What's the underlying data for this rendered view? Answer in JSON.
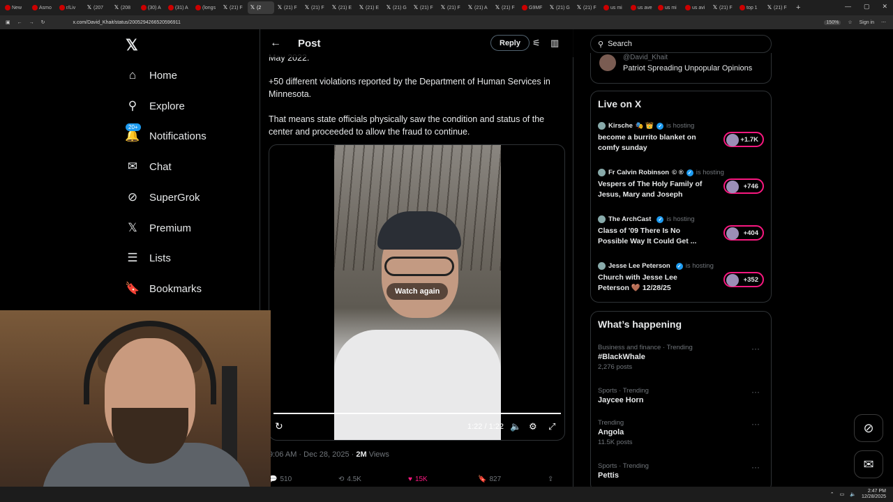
{
  "browser": {
    "tabs": [
      "New",
      "Asmo",
      "r/Liv",
      "(207",
      "(208",
      "(30) A",
      "(31) A",
      "(longs",
      "(21) F",
      "(2",
      "(21) F",
      "(21) F",
      "(21) E",
      "(21) E",
      "(21) G",
      "(21) F",
      "(21) F",
      "(21) A",
      "(21) F",
      "G9MF",
      "(21) G",
      "(21) F",
      "us mi",
      "us ave",
      "us mi",
      "us avi",
      "(21) F",
      "top 1",
      "(21) F"
    ],
    "active_tab_index": 9,
    "url": "x.com/David_Khait/status/2005294266520596911",
    "zoom": "150%",
    "profile": "Sign in"
  },
  "nav": {
    "items": [
      {
        "label": "Home",
        "icon": "home-icon",
        "glyph": "⌂"
      },
      {
        "label": "Explore",
        "icon": "search-icon",
        "glyph": "⚲"
      },
      {
        "label": "Notifications",
        "icon": "bell-icon",
        "glyph": "🔔",
        "badge": "20+"
      },
      {
        "label": "Chat",
        "icon": "mail-icon",
        "glyph": "✉"
      },
      {
        "label": "SuperGrok",
        "icon": "grok-icon",
        "glyph": "⊘"
      },
      {
        "label": "Premium",
        "icon": "x-logo-icon",
        "glyph": "𝕏"
      },
      {
        "label": "Lists",
        "icon": "list-icon",
        "glyph": "☰"
      },
      {
        "label": "Bookmarks",
        "icon": "bookmark-icon",
        "glyph": "🔖"
      }
    ]
  },
  "post": {
    "header_title": "Post",
    "reply_label": "Reply",
    "text_partial": "May 2022.",
    "para1": "+50 different violations reported by the Department of Human Services in Minnesota.",
    "para2": "That means state officials physically saw the condition and status of the center and proceeded to allow the fraud to continue.",
    "video": {
      "overlay": "Watch again",
      "time": "1:22 / 1:22",
      "progress": 1.0
    },
    "meta_time": "9:06 AM · Dec 28, 2025 · ",
    "views_count": "2M",
    "views_label": " Views",
    "stats": {
      "replies": "510",
      "reposts": "4.5K",
      "likes": "15K",
      "bookmarks": "827"
    }
  },
  "sidebar": {
    "search_placeholder": "Search",
    "promo_handle": "@David_Khait",
    "promo_bio": "Patriot Spreading Unpopular Opinions",
    "live_title": "Live on X",
    "live": [
      {
        "host": "Kirsche",
        "emojis": "🎭 👑",
        "status": "is hosting",
        "topic": "become a burrito blanket on comfy sunday",
        "count": "+1.7K"
      },
      {
        "host": "Fr Calvin Robinson",
        "emojis": "© ®",
        "status": "is hosting",
        "topic": "Vespers of The Holy Family of Jesus, Mary and Joseph",
        "count": "+746"
      },
      {
        "host": "The ArchCast",
        "emojis": "",
        "status": "is hosting",
        "topic": "Class of '09 There Is No Possible Way It Could Get ...",
        "count": "+404"
      },
      {
        "host": "Jesse Lee Peterson",
        "emojis": "",
        "status": "is hosting",
        "topic": "Church with Jesse Lee Peterson 🤎 12/28/25",
        "count": "+352"
      }
    ],
    "trending_title": "What’s happening",
    "trends": [
      {
        "context": "Business and finance · Trending",
        "name": "#BlackWhale",
        "count": "2,276 posts"
      },
      {
        "context": "Sports · Trending",
        "name": "Jaycee Horn",
        "count": ""
      },
      {
        "context": "Trending",
        "name": "Angola",
        "count": "11.5K posts"
      },
      {
        "context": "Sports · Trending",
        "name": "Pettis",
        "count": ""
      }
    ]
  },
  "taskbar": {
    "time": "2:47 PM",
    "date": "12/28/2025"
  },
  "colors": {
    "accent": "#1d9bf0",
    "like": "#f91880",
    "border": "#2f3336",
    "muted": "#71767b"
  }
}
